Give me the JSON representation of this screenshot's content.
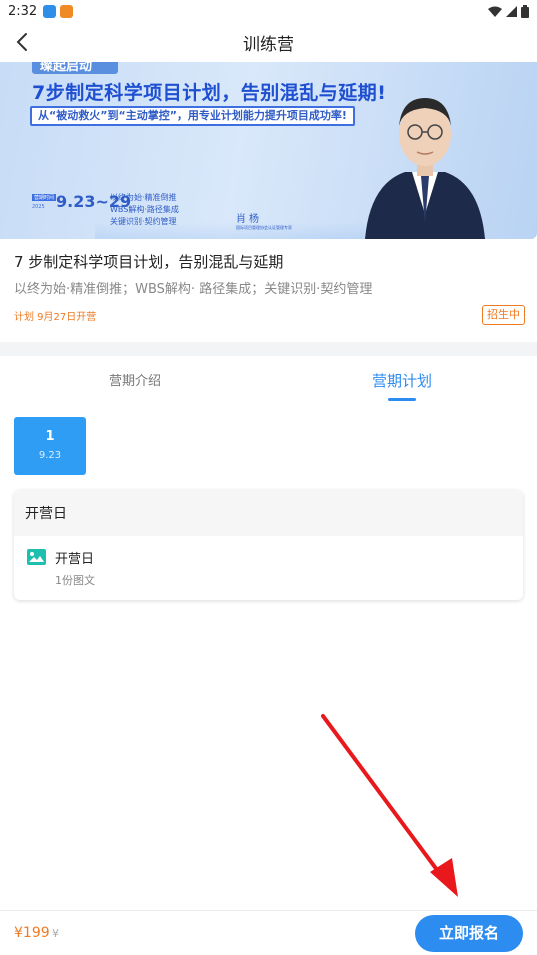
{
  "status_bar": {
    "time": "2:32"
  },
  "nav": {
    "title": "训练营"
  },
  "banner": {
    "tag": "璨起启动",
    "title": "7步制定科学项目计划，告别混乱与延期!",
    "subtitle": "从“被动救火”到“主动掌控”，用专业计划能力提升项目成功率!",
    "date_label": "营期时间",
    "date_year": "2025",
    "date": "9.23~29",
    "bullets": [
      "以终为始·精准倒推",
      "WBS解构·路径集成",
      "关键识别·契约管理"
    ],
    "lecturer": "肖杨",
    "lecturer_desc": "国际项目管理协会认证管理专家"
  },
  "course": {
    "title": "7 步制定科学项目计划，告别混乱与延期",
    "desc": "以终为始·精准倒推；WBS解构· 路径集成；关键识别·契约管理",
    "start": "计划 9月27日开营",
    "status": "招生中"
  },
  "tabs": {
    "intro": "营期介绍",
    "plan": "营期计划"
  },
  "day": {
    "number": "1",
    "date": "9.23"
  },
  "schedule": {
    "header": "开营日",
    "item_title": "开营日",
    "item_sub": "1份图文"
  },
  "bottom": {
    "price": "¥199",
    "orig_price": "¥",
    "signup": "立即报名"
  },
  "colors": {
    "accent": "#2d8cf0",
    "orange": "#ef7a24",
    "arrow": "#e8181c"
  }
}
